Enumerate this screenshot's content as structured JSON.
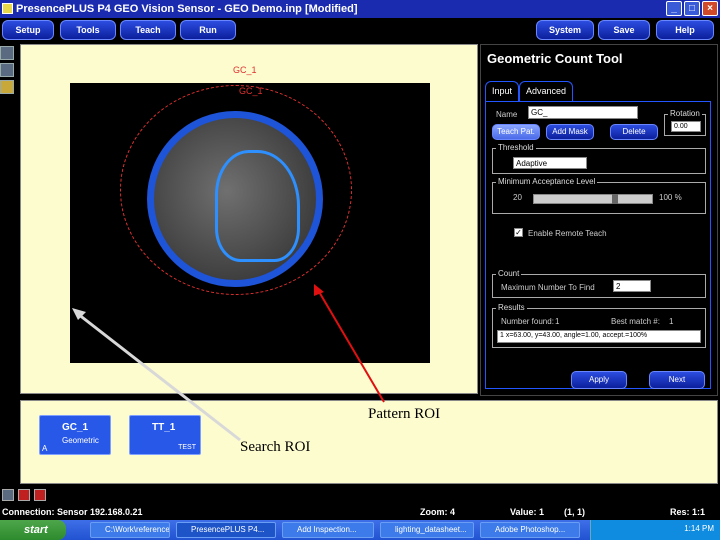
{
  "window": {
    "title": "PresencePLUS P4 GEO Vision Sensor - GEO Demo.inp [Modified]"
  },
  "menu": {
    "items": [
      "Setup",
      "Tools",
      "Teach",
      "Run"
    ],
    "right_items": [
      "System",
      "Save",
      "Help"
    ]
  },
  "canvas": {
    "pattern_label": "GC_1",
    "search_label": "GC_1"
  },
  "panel": {
    "title": "Geometric Count Tool",
    "tabs": [
      "Input",
      "Advanced"
    ],
    "name_label": "Name",
    "name_value": "GC_",
    "rotation_label": "Rotation",
    "rotation_value": "0.00",
    "buttons": [
      "Teach Pat.",
      "Add Mask",
      "Delete"
    ],
    "threshold_label": "Threshold",
    "threshold_value": "Adaptive",
    "min_acceptance_label": "Minimum Acceptance Level",
    "min_value": "20",
    "max_value": "100 %",
    "enable_remote_teach": "Enable Remote Teach",
    "count_label": "Count",
    "max_number_label": "Maximum Number To Find",
    "max_number_value": "2",
    "results_label": "Results",
    "number_found_label": "Number found:",
    "number_found_value": "1",
    "best_match_label": "Best match #:",
    "best_match_value": "1",
    "result_row": "1 x=63.00, y=43.00, angle=1.00, accept.=100%",
    "apply": "Apply",
    "next": "Next"
  },
  "tools": [
    {
      "name": "GC_1",
      "sub": "Geometric",
      "corner": "A"
    },
    {
      "name": "TT_1",
      "sub": "TEST",
      "corner": ""
    }
  ],
  "annotations": {
    "pattern": "Pattern ROI",
    "search": "Search ROI"
  },
  "status": {
    "connection": "Connection: Sensor 192.168.0.21",
    "zoom": "Zoom: 4",
    "value": "Value: 1",
    "coord": "(1, 1)",
    "res": "Res: 1:1"
  },
  "taskbar": {
    "start": "start",
    "items": [
      "C:\\Work\\reference...",
      "PresencePLUS P4...",
      "Add Inspection...",
      "lighting_datasheet...",
      "Adobe Photoshop..."
    ],
    "clock": "1:14 PM"
  }
}
